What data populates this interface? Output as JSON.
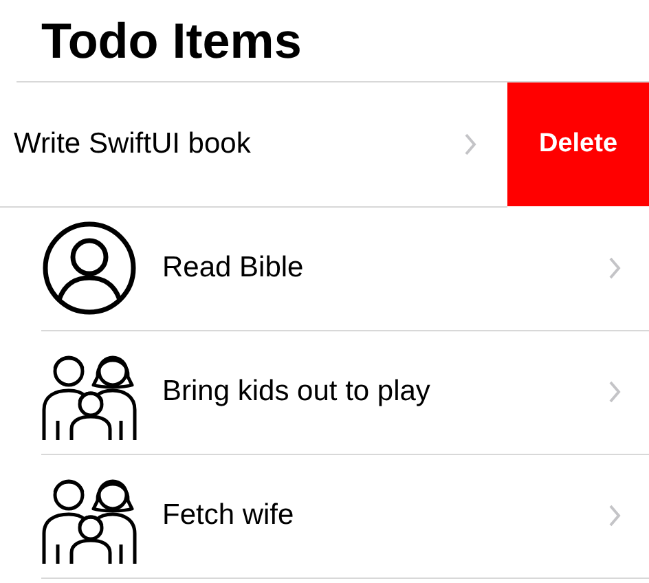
{
  "title": "Todo Items",
  "items": [
    {
      "label": "Write SwiftUI book",
      "swiped": true,
      "action": "Delete"
    },
    {
      "label": "Read Bible",
      "kind": "person",
      "swiped": false
    },
    {
      "label": "Bring kids out to play",
      "kind": "family",
      "swiped": false
    },
    {
      "label": "Fetch wife",
      "kind": "family",
      "swiped": false
    }
  ]
}
